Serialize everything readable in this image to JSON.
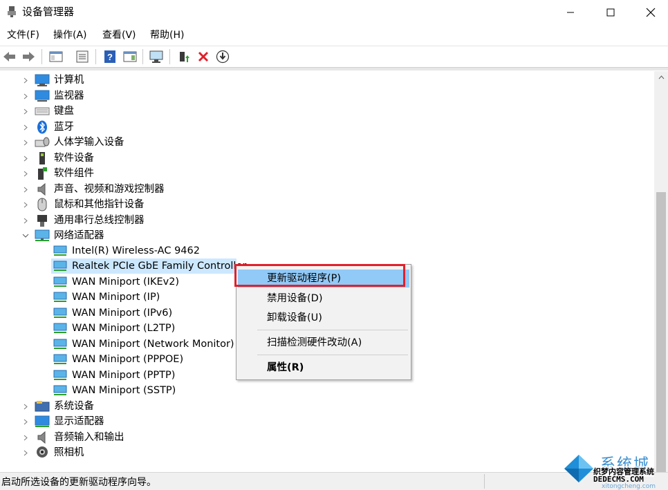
{
  "window": {
    "title": "设备管理器",
    "controls": [
      "minimize",
      "maximize",
      "close"
    ]
  },
  "menubar": {
    "items": [
      "文件(F)",
      "操作(A)",
      "查看(V)",
      "帮助(H)"
    ]
  },
  "toolbar": {
    "buttons": [
      "back-icon",
      "forward-icon",
      "show-hide-console-tree-icon",
      "properties-icon",
      "help-icon",
      "action-pane-icon",
      "scan-hardware-icon",
      "update-driver-icon",
      "uninstall-icon",
      "disable-icon"
    ]
  },
  "tree": {
    "categories": [
      {
        "label": "计算机",
        "icon": "computer-icon",
        "expanded": false
      },
      {
        "label": "监视器",
        "icon": "monitor-icon",
        "expanded": false
      },
      {
        "label": "键盘",
        "icon": "keyboard-icon",
        "expanded": false
      },
      {
        "label": "蓝牙",
        "icon": "bluetooth-icon",
        "expanded": false
      },
      {
        "label": "人体学输入设备",
        "icon": "hid-icon",
        "expanded": false
      },
      {
        "label": "软件设备",
        "icon": "software-device-icon",
        "expanded": false
      },
      {
        "label": "软件组件",
        "icon": "software-component-icon",
        "expanded": false
      },
      {
        "label": "声音、视频和游戏控制器",
        "icon": "speaker-icon",
        "expanded": false
      },
      {
        "label": "鼠标和其他指针设备",
        "icon": "mouse-icon",
        "expanded": false
      },
      {
        "label": "通用串行总线控制器",
        "icon": "usb-icon",
        "expanded": false
      },
      {
        "label": "网络适配器",
        "icon": "network-icon",
        "expanded": true
      },
      {
        "label": "系统设备",
        "icon": "system-device-icon",
        "expanded": false
      },
      {
        "label": "显示适配器",
        "icon": "display-adapter-icon",
        "expanded": false
      },
      {
        "label": "音频输入和输出",
        "icon": "audio-icon",
        "expanded": false
      },
      {
        "label": "照相机",
        "icon": "camera-icon",
        "expanded": false
      }
    ],
    "network_adapters": [
      "Intel(R) Wireless-AC 9462",
      "Realtek PCIe GbE Family Controller",
      "WAN Miniport (IKEv2)",
      "WAN Miniport (IP)",
      "WAN Miniport (IPv6)",
      "WAN Miniport (L2TP)",
      "WAN Miniport (Network Monitor)",
      "WAN Miniport (PPPOE)",
      "WAN Miniport (PPTP)",
      "WAN Miniport (SSTP)"
    ],
    "selected": "Realtek PCIe GbE Family Controller"
  },
  "context_menu": {
    "items": [
      "更新驱动程序(P)",
      "禁用设备(D)",
      "卸载设备(U)",
      "扫描检测硬件改动(A)",
      "属性(R)"
    ],
    "highlighted": "更新驱动程序(P)",
    "highlight_color": "#91c9f7",
    "annotation_color": "#e0202a"
  },
  "statusbar": {
    "text": "启动所选设备的更新驱动程序向导。"
  },
  "watermark": {
    "line1": "系统城",
    "line2": "xitongcheng.com",
    "overlay1": "织梦内容管理系统",
    "overlay2": "DEDECMS.COM"
  }
}
